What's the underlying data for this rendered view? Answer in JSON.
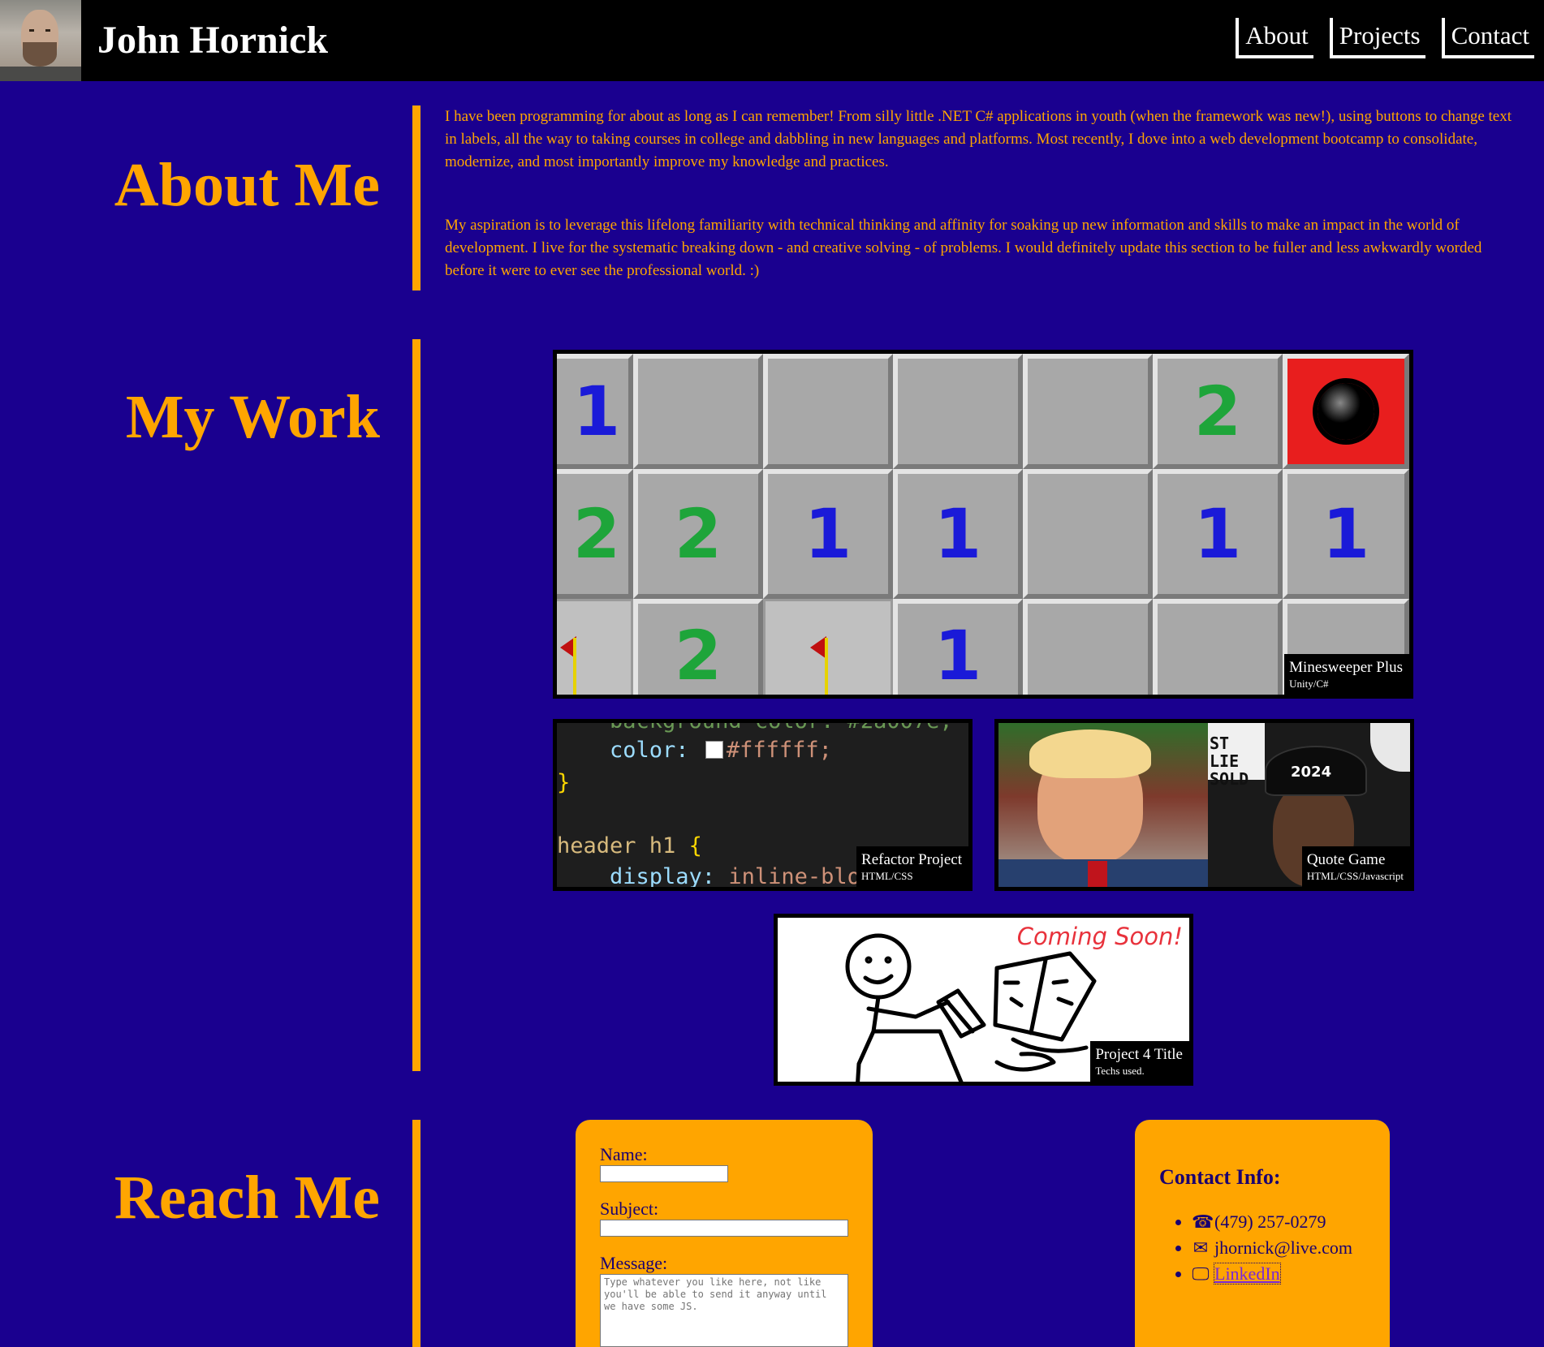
{
  "header": {
    "name": "John Hornick",
    "nav": [
      {
        "label": "About"
      },
      {
        "label": "Projects"
      },
      {
        "label": "Contact"
      }
    ]
  },
  "about": {
    "title": "About Me",
    "paragraphs": [
      "I have been programming for about as long as I can remember! From silly little .NET C# applications in youth (when the framework was new!), using buttons to change text in labels, all the way to taking courses in college and dabbling in new languages and platforms. Most recently, I dove into a web development bootcamp to consolidate, modernize, and most importantly improve my knowledge and practices.",
      "My aspiration is to leverage this lifelong familiarity with technical thinking and affinity for soaking up new information and skills to make an impact in the world of development. I live for the systematic breaking down - and creative solving - of problems. I would definitely update this section to be fuller and less awkwardly worded before it were to ever see the professional world. :)"
    ]
  },
  "work": {
    "title": "My Work",
    "projects": [
      {
        "title": "Minesweeper Plus",
        "tech": "Unity/C#"
      },
      {
        "title": "Refactor Project",
        "tech": "HTML/CSS"
      },
      {
        "title": "Quote Game",
        "tech": "HTML/CSS/Javascript"
      },
      {
        "title": "Project 4 Title",
        "tech": "Techs used.",
        "banner": "Coming Soon!"
      }
    ],
    "code_snippet": {
      "line1": "    color: ",
      "line1_value": "#ffffff;",
      "line2": "}",
      "line3_selector": "header h1 ",
      "line3_brace": "{",
      "line4_prop": "    display: ",
      "line4_value": "inline-blo"
    },
    "quote_image_text": {
      "cap": "2024",
      "sign": "ST LIE SOLD"
    },
    "minesweeper_cells": [
      "1",
      "",
      "",
      "",
      "",
      "2",
      "mine",
      "2",
      "2",
      "1",
      "1",
      "",
      "1",
      "1",
      "flag",
      "2",
      "flag",
      "1",
      "",
      "",
      ""
    ]
  },
  "contact": {
    "title": "Reach Me",
    "form": {
      "name_label": "Name:",
      "subject_label": "Subject:",
      "message_label": "Message:",
      "message_placeholder": "Type whatever you like here, not like you'll be able to send it anyway until we have some JS."
    },
    "info": {
      "heading": "Contact Info:",
      "phone": "(479) 257-0279",
      "email": "jhornick@live.com",
      "linkedin": "LinkedIn"
    }
  },
  "colors": {
    "background": "#1a008f",
    "accent": "#ffa500",
    "header": "#000000"
  },
  "icons": {
    "phone": "phone-icon",
    "email": "envelope-icon",
    "linkedin": "monitor-icon"
  }
}
